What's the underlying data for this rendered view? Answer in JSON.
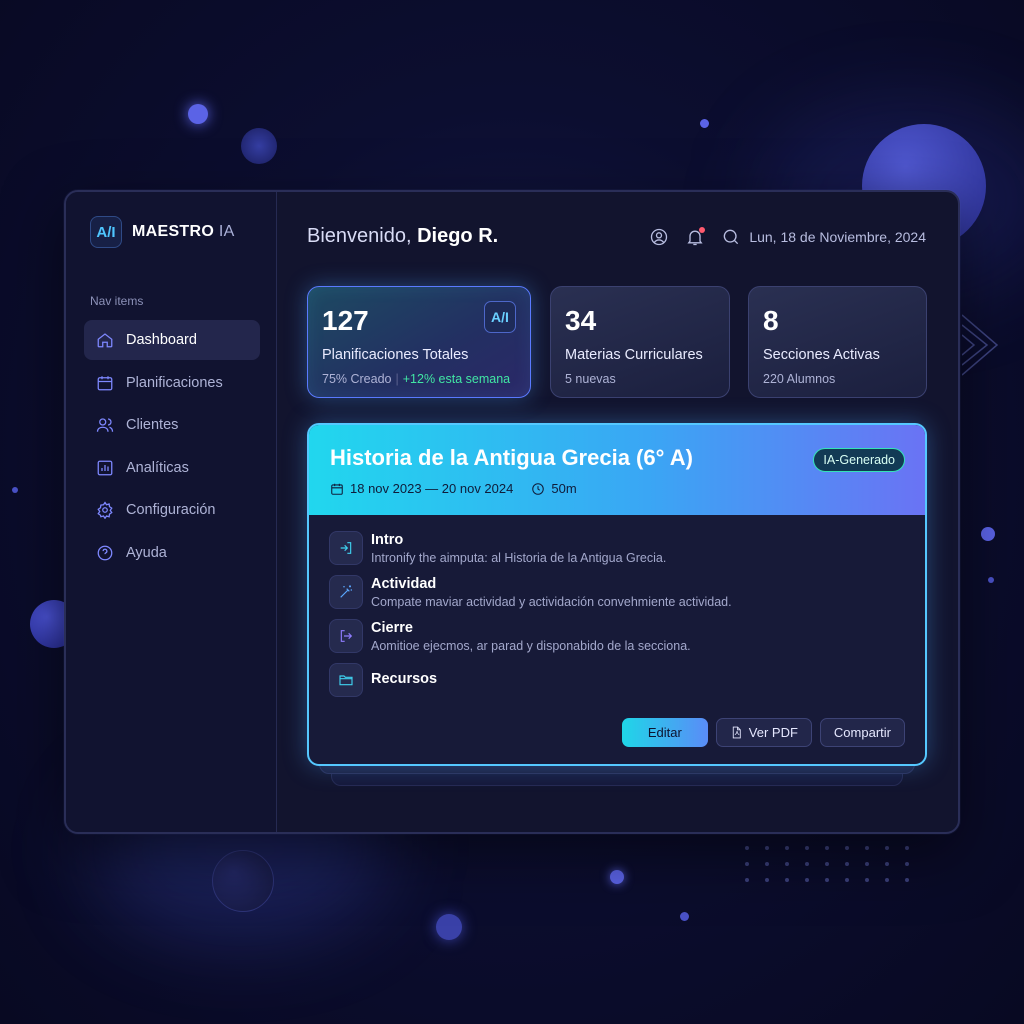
{
  "app": {
    "logo_text": "A/I",
    "name": "MAESTRO",
    "name_suffix": "IA"
  },
  "sidebar": {
    "heading": "Nav items",
    "items": [
      {
        "label": "Dashboard",
        "icon": "home-icon",
        "active": true
      },
      {
        "label": "Planificaciones",
        "icon": "calendar-icon"
      },
      {
        "label": "Clientes",
        "icon": "users-icon"
      },
      {
        "label": "Analíticas",
        "icon": "chart-icon"
      },
      {
        "label": "Configuración",
        "icon": "gear-icon"
      },
      {
        "label": "Ayuda",
        "icon": "help-icon"
      }
    ]
  },
  "header": {
    "greeting": "Bienvenido,",
    "user": "Diego R.",
    "date": "Lun, 18 de Noviembre, 2024"
  },
  "stats": [
    {
      "value": "127",
      "label": "Planificaciones Totales",
      "sub": "75% Creado",
      "trend": "+12% esta semana",
      "badge": "A/I"
    },
    {
      "value": "34",
      "label": "Materias Curriculares",
      "sub": "5 nuevas"
    },
    {
      "value": "8",
      "label": "Secciones Activas",
      "sub": "220 Alumnos"
    }
  ],
  "plan": {
    "title": "Historia de la Antigua Grecia (6° A)",
    "dates": "18 nov 2023 — 20 nov 2024",
    "duration": "50m",
    "badge": "IA-Generado",
    "steps": [
      {
        "title": "Intro",
        "desc": "Intronify the aimputa: al Historia de la Antigua Grecia.",
        "icon": "login-icon"
      },
      {
        "title": "Actividad",
        "desc": "Compate maviar actividad y actividación convehmiente actividad.",
        "icon": "magic-wand-icon"
      },
      {
        "title": "Cierre",
        "desc": "Aomitioe ejecmos, ar parad y disponabido de la secciona.",
        "icon": "logout-icon"
      },
      {
        "title": "Recursos",
        "icon": "folder-icon"
      }
    ],
    "actions": {
      "edit": "Editar",
      "pdf": "Ver PDF",
      "share": "Compartir"
    }
  },
  "colors": {
    "accent": "#7e88ff",
    "cyan": "#21d7ee",
    "trend_up": "#41e6a4",
    "notification": "#ff5a6e"
  }
}
